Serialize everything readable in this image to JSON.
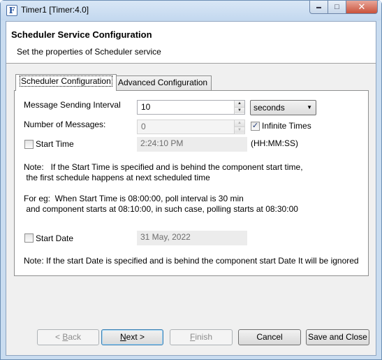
{
  "window": {
    "title": "Timer1 [Timer:4.0]",
    "icon_letter": "F",
    "controls": {
      "minimize": "▬",
      "maximize": "□",
      "close": "✕"
    }
  },
  "header": {
    "title": "Scheduler Service Configuration",
    "subtitle": "Set the properties of Scheduler service"
  },
  "tabs": [
    {
      "label": "Scheduler Configuration",
      "active": true
    },
    {
      "label": "Advanced Configuration",
      "active": false
    }
  ],
  "form": {
    "message_interval": {
      "label": "Message Sending Interval",
      "value": "10",
      "unit": "seconds"
    },
    "number_of_messages": {
      "label": "Number of Messages:",
      "value": "0"
    },
    "infinite_times": {
      "label": "Infinite Times",
      "checked": true
    },
    "start_time": {
      "label": "Start Time",
      "checked": false,
      "value": "2:24:10 PM",
      "format": "(HH:MM:SS)"
    },
    "note_time": "Note:   If the Start Time is specified and is behind the component start time,\n the first schedule happens at next scheduled time",
    "example": "For eg:  When Start Time is 08:00:00, poll interval is 30 min\n and component starts at 08:10:00, in such case, polling starts at 08:30:00",
    "start_date": {
      "label": "Start Date",
      "checked": false,
      "value": "31 May, 2022"
    },
    "note_date": "Note: If the start Date is specified and is behind the component start Date It will be ignored"
  },
  "buttons": {
    "back_prefix": "< ",
    "back_key": "B",
    "back_rest": "ack",
    "next_key": "N",
    "next_rest": "ext >",
    "finish_key": "F",
    "finish_rest": "inish",
    "cancel": "Cancel",
    "save_close": "Save and Close"
  },
  "icons": {
    "spin_up": "▲",
    "spin_down": "▼",
    "combo_arrow": "▼",
    "check_mark": "✓"
  }
}
